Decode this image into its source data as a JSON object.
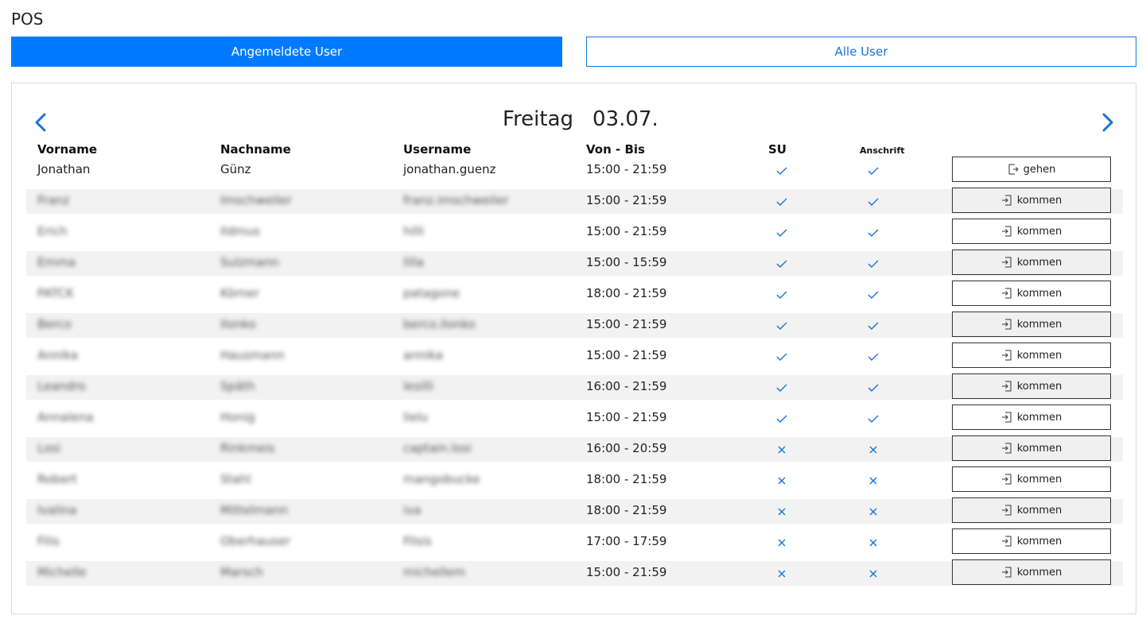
{
  "app": {
    "title": "POS"
  },
  "tabs": [
    {
      "label": "Angemeldete User",
      "active": true
    },
    {
      "label": "Alle User",
      "active": false
    }
  ],
  "day": {
    "weekday": "Freitag",
    "date": "03.07."
  },
  "nav": {
    "prev_icon": "chevron-left-icon",
    "next_icon": "chevron-right-icon"
  },
  "columns": {
    "vorname": "Vorname",
    "nachname": "Nachname",
    "username": "Username",
    "von_bis": "Von - Bis",
    "su": "SU",
    "anschrift": "Anschrift"
  },
  "colors": {
    "accent": "#007bff",
    "check": "#1a73d6",
    "row_shade": "#f2f2f2"
  },
  "rows": [
    {
      "vorname": "Jonathan",
      "nachname": "Günz",
      "username": "jonathan.guenz",
      "time": "15:00 - 21:59",
      "su": true,
      "anschrift": true,
      "action": "gehen",
      "blurred": false
    },
    {
      "vorname": "Franz",
      "nachname": "Imschweiler",
      "username": "franz.imschweiler",
      "time": "15:00 - 21:59",
      "su": true,
      "anschrift": true,
      "action": "kommen",
      "blurred": true
    },
    {
      "vorname": "Erich",
      "nachname": "Ildmus",
      "username": "hilli",
      "time": "15:00 - 21:59",
      "su": true,
      "anschrift": true,
      "action": "kommen",
      "blurred": true
    },
    {
      "vorname": "Emma",
      "nachname": "Sulzmann",
      "username": "lilla",
      "time": "15:00 - 15:59",
      "su": true,
      "anschrift": true,
      "action": "kommen",
      "blurred": true
    },
    {
      "vorname": "PATCK",
      "nachname": "Körner",
      "username": "patagone",
      "time": "18:00 - 21:59",
      "su": true,
      "anschrift": true,
      "action": "kommen",
      "blurred": true
    },
    {
      "vorname": "Berco",
      "nachname": "Ilonko",
      "username": "berco.ilonko",
      "time": "15:00 - 21:59",
      "su": true,
      "anschrift": true,
      "action": "kommen",
      "blurred": true
    },
    {
      "vorname": "Annika",
      "nachname": "Hausmann",
      "username": "annika",
      "time": "15:00 - 21:59",
      "su": true,
      "anschrift": true,
      "action": "kommen",
      "blurred": true
    },
    {
      "vorname": "Leandro",
      "nachname": "Späth",
      "username": "lesilli",
      "time": "16:00 - 21:59",
      "su": true,
      "anschrift": true,
      "action": "kommen",
      "blurred": true
    },
    {
      "vorname": "Annalena",
      "nachname": "Honig",
      "username": "lielu",
      "time": "15:00 - 21:59",
      "su": true,
      "anschrift": true,
      "action": "kommen",
      "blurred": true
    },
    {
      "vorname": "Losi",
      "nachname": "Rinkmeis",
      "username": "captain.losi",
      "time": "16:00 - 20:59",
      "su": false,
      "anschrift": false,
      "action": "kommen",
      "blurred": true
    },
    {
      "vorname": "Robert",
      "nachname": "Stahl",
      "username": "mangobucke",
      "time": "18:00 - 21:59",
      "su": false,
      "anschrift": false,
      "action": "kommen",
      "blurred": true
    },
    {
      "vorname": "Ivalina",
      "nachname": "Mittelmann",
      "username": "iva",
      "time": "18:00 - 21:59",
      "su": false,
      "anschrift": false,
      "action": "kommen",
      "blurred": true
    },
    {
      "vorname": "Filis",
      "nachname": "Oberhauser",
      "username": "Filsis",
      "time": "17:00 - 17:59",
      "su": false,
      "anschrift": false,
      "action": "kommen",
      "blurred": true
    },
    {
      "vorname": "Michelle",
      "nachname": "Marsch",
      "username": "michellem",
      "time": "15:00 - 21:59",
      "su": false,
      "anschrift": false,
      "action": "kommen",
      "blurred": true
    }
  ]
}
